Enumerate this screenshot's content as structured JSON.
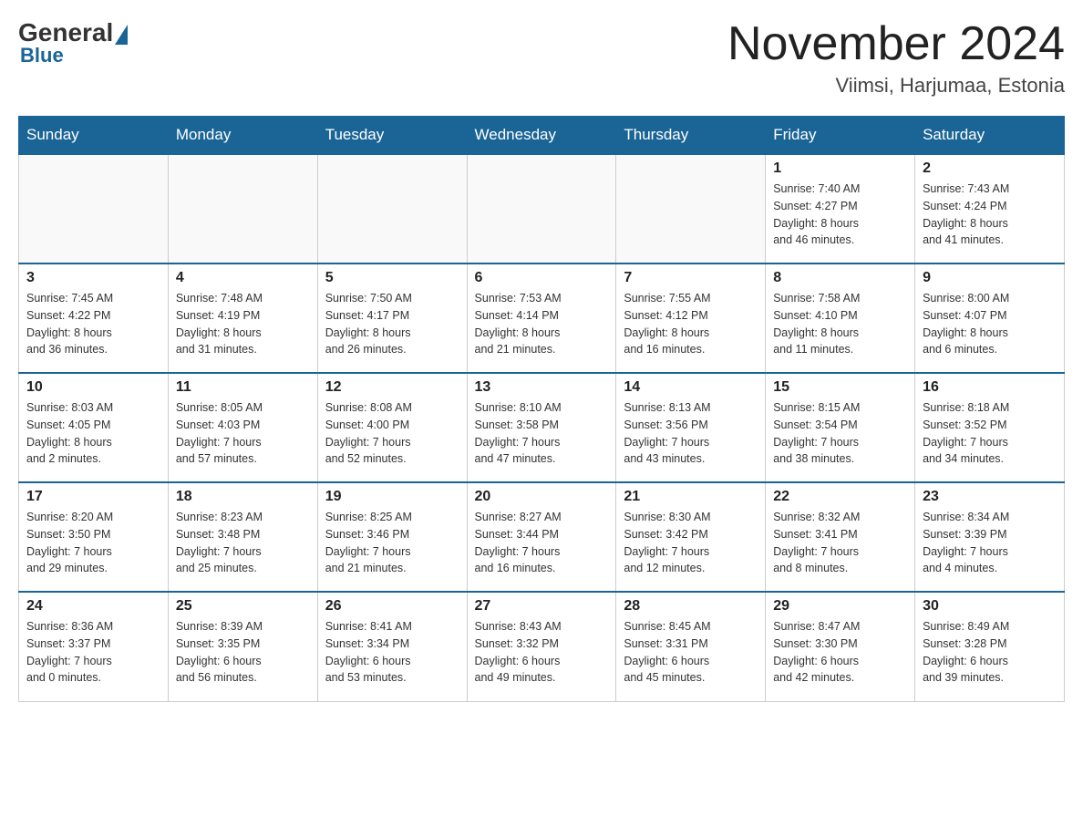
{
  "header": {
    "logo": {
      "general": "General",
      "blue": "Blue"
    },
    "title": "November 2024",
    "location": "Viimsi, Harjumaa, Estonia"
  },
  "weekdays": [
    "Sunday",
    "Monday",
    "Tuesday",
    "Wednesday",
    "Thursday",
    "Friday",
    "Saturday"
  ],
  "weeks": [
    [
      {
        "day": "",
        "info": ""
      },
      {
        "day": "",
        "info": ""
      },
      {
        "day": "",
        "info": ""
      },
      {
        "day": "",
        "info": ""
      },
      {
        "day": "",
        "info": ""
      },
      {
        "day": "1",
        "info": "Sunrise: 7:40 AM\nSunset: 4:27 PM\nDaylight: 8 hours\nand 46 minutes."
      },
      {
        "day": "2",
        "info": "Sunrise: 7:43 AM\nSunset: 4:24 PM\nDaylight: 8 hours\nand 41 minutes."
      }
    ],
    [
      {
        "day": "3",
        "info": "Sunrise: 7:45 AM\nSunset: 4:22 PM\nDaylight: 8 hours\nand 36 minutes."
      },
      {
        "day": "4",
        "info": "Sunrise: 7:48 AM\nSunset: 4:19 PM\nDaylight: 8 hours\nand 31 minutes."
      },
      {
        "day": "5",
        "info": "Sunrise: 7:50 AM\nSunset: 4:17 PM\nDaylight: 8 hours\nand 26 minutes."
      },
      {
        "day": "6",
        "info": "Sunrise: 7:53 AM\nSunset: 4:14 PM\nDaylight: 8 hours\nand 21 minutes."
      },
      {
        "day": "7",
        "info": "Sunrise: 7:55 AM\nSunset: 4:12 PM\nDaylight: 8 hours\nand 16 minutes."
      },
      {
        "day": "8",
        "info": "Sunrise: 7:58 AM\nSunset: 4:10 PM\nDaylight: 8 hours\nand 11 minutes."
      },
      {
        "day": "9",
        "info": "Sunrise: 8:00 AM\nSunset: 4:07 PM\nDaylight: 8 hours\nand 6 minutes."
      }
    ],
    [
      {
        "day": "10",
        "info": "Sunrise: 8:03 AM\nSunset: 4:05 PM\nDaylight: 8 hours\nand 2 minutes."
      },
      {
        "day": "11",
        "info": "Sunrise: 8:05 AM\nSunset: 4:03 PM\nDaylight: 7 hours\nand 57 minutes."
      },
      {
        "day": "12",
        "info": "Sunrise: 8:08 AM\nSunset: 4:00 PM\nDaylight: 7 hours\nand 52 minutes."
      },
      {
        "day": "13",
        "info": "Sunrise: 8:10 AM\nSunset: 3:58 PM\nDaylight: 7 hours\nand 47 minutes."
      },
      {
        "day": "14",
        "info": "Sunrise: 8:13 AM\nSunset: 3:56 PM\nDaylight: 7 hours\nand 43 minutes."
      },
      {
        "day": "15",
        "info": "Sunrise: 8:15 AM\nSunset: 3:54 PM\nDaylight: 7 hours\nand 38 minutes."
      },
      {
        "day": "16",
        "info": "Sunrise: 8:18 AM\nSunset: 3:52 PM\nDaylight: 7 hours\nand 34 minutes."
      }
    ],
    [
      {
        "day": "17",
        "info": "Sunrise: 8:20 AM\nSunset: 3:50 PM\nDaylight: 7 hours\nand 29 minutes."
      },
      {
        "day": "18",
        "info": "Sunrise: 8:23 AM\nSunset: 3:48 PM\nDaylight: 7 hours\nand 25 minutes."
      },
      {
        "day": "19",
        "info": "Sunrise: 8:25 AM\nSunset: 3:46 PM\nDaylight: 7 hours\nand 21 minutes."
      },
      {
        "day": "20",
        "info": "Sunrise: 8:27 AM\nSunset: 3:44 PM\nDaylight: 7 hours\nand 16 minutes."
      },
      {
        "day": "21",
        "info": "Sunrise: 8:30 AM\nSunset: 3:42 PM\nDaylight: 7 hours\nand 12 minutes."
      },
      {
        "day": "22",
        "info": "Sunrise: 8:32 AM\nSunset: 3:41 PM\nDaylight: 7 hours\nand 8 minutes."
      },
      {
        "day": "23",
        "info": "Sunrise: 8:34 AM\nSunset: 3:39 PM\nDaylight: 7 hours\nand 4 minutes."
      }
    ],
    [
      {
        "day": "24",
        "info": "Sunrise: 8:36 AM\nSunset: 3:37 PM\nDaylight: 7 hours\nand 0 minutes."
      },
      {
        "day": "25",
        "info": "Sunrise: 8:39 AM\nSunset: 3:35 PM\nDaylight: 6 hours\nand 56 minutes."
      },
      {
        "day": "26",
        "info": "Sunrise: 8:41 AM\nSunset: 3:34 PM\nDaylight: 6 hours\nand 53 minutes."
      },
      {
        "day": "27",
        "info": "Sunrise: 8:43 AM\nSunset: 3:32 PM\nDaylight: 6 hours\nand 49 minutes."
      },
      {
        "day": "28",
        "info": "Sunrise: 8:45 AM\nSunset: 3:31 PM\nDaylight: 6 hours\nand 45 minutes."
      },
      {
        "day": "29",
        "info": "Sunrise: 8:47 AM\nSunset: 3:30 PM\nDaylight: 6 hours\nand 42 minutes."
      },
      {
        "day": "30",
        "info": "Sunrise: 8:49 AM\nSunset: 3:28 PM\nDaylight: 6 hours\nand 39 minutes."
      }
    ]
  ]
}
